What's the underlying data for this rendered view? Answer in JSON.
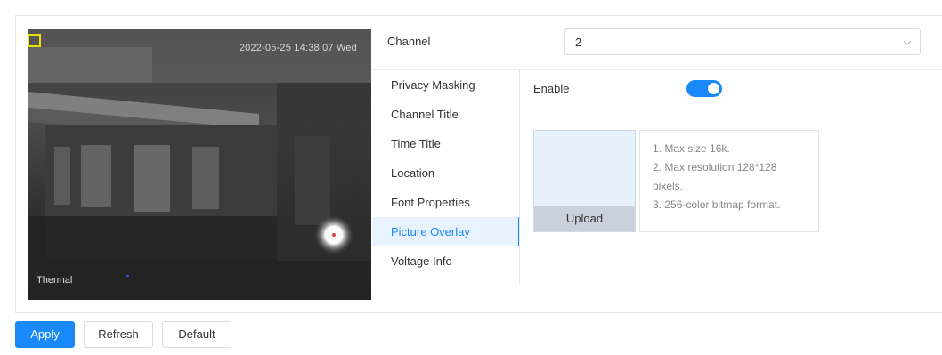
{
  "video": {
    "timestamp": "2022-05-25 14:38:07 Wed",
    "channel_name": "Thermal"
  },
  "channel": {
    "label": "Channel",
    "value": "2"
  },
  "menu": {
    "items": [
      {
        "label": "Privacy Masking"
      },
      {
        "label": "Channel Title"
      },
      {
        "label": "Time Title"
      },
      {
        "label": "Location"
      },
      {
        "label": "Font Properties"
      },
      {
        "label": "Picture Overlay"
      },
      {
        "label": "Voltage Info"
      }
    ],
    "active": "Picture Overlay"
  },
  "picture_overlay": {
    "enable_label": "Enable",
    "enabled": true,
    "upload_label": "Upload",
    "tips": [
      "1. Max size 16k.",
      "2. Max resolution 128*128",
      "pixels.",
      "3. 256-color bitmap format."
    ]
  },
  "buttons": {
    "apply": "Apply",
    "refresh": "Refresh",
    "default": "Default"
  },
  "colors": {
    "accent": "#1989fa",
    "active_bg": "#e8f3ff",
    "upload_bg": "#e7f1fc",
    "upload_btn_bg": "#c9d2dc"
  }
}
